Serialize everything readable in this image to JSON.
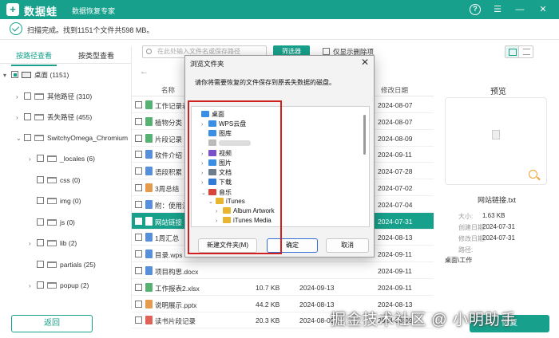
{
  "app": {
    "name": "数据蛙",
    "subtitle": "数据恢复专家",
    "help": "?",
    "menu": "☰",
    "minimize": "—",
    "close": "✕"
  },
  "status": {
    "text": "扫描完成。找到1151个文件共598 MB。"
  },
  "left_tabs": [
    "按路径查看",
    "按类型查看"
  ],
  "tree": [
    {
      "label": "桌面 (1151)",
      "level": 0,
      "arrow": "▾",
      "type": "drive"
    },
    {
      "label": "其他路径 (310)",
      "level": 1,
      "arrow": "›",
      "type": "folder"
    },
    {
      "label": "丢失路径 (455)",
      "level": 1,
      "arrow": "›",
      "type": "folder"
    },
    {
      "label": "SwitchyOmega_Chromium",
      "level": 1,
      "arrow": "⌄",
      "type": "folder"
    },
    {
      "label": "_locales (6)",
      "level": 2,
      "arrow": "›",
      "type": "folder"
    },
    {
      "label": "css (0)",
      "level": 2,
      "arrow": "",
      "type": "folder"
    },
    {
      "label": "img (0)",
      "level": 2,
      "arrow": "",
      "type": "folder"
    },
    {
      "label": "js (0)",
      "level": 2,
      "arrow": "",
      "type": "folder"
    },
    {
      "label": "lib (2)",
      "level": 2,
      "arrow": "›",
      "type": "folder"
    },
    {
      "label": "partials (25)",
      "level": 2,
      "arrow": "",
      "type": "folder"
    },
    {
      "label": "popup (2)",
      "level": 2,
      "arrow": "›",
      "type": "folder"
    }
  ],
  "toolbar": {
    "search_placeholder": "在此处输入文件名或保存路径",
    "filter_label": "筛选器",
    "only_deleted": "仅显示删除项"
  },
  "columns": {
    "name": "名称",
    "mtime": "修改日期"
  },
  "files": [
    {
      "name": "工作记录表",
      "size": "",
      "ctime": "",
      "mtime": "2024-08-07",
      "color": "#3aa35a",
      "selected": false
    },
    {
      "name": "植物分类",
      "size": "",
      "ctime": "",
      "mtime": "2024-08-07",
      "color": "#3aa35a",
      "selected": false
    },
    {
      "name": "片段记录",
      "size": "",
      "ctime": "",
      "mtime": "2024-08-09",
      "color": "#3aa35a",
      "selected": false
    },
    {
      "name": "软件介绍",
      "size": "",
      "ctime": "",
      "mtime": "2024-09-11",
      "color": "#3a7bd5",
      "selected": false
    },
    {
      "name": "语段积累",
      "size": "",
      "ctime": "",
      "mtime": "2024-07-28",
      "color": "#3a7bd5",
      "selected": false
    },
    {
      "name": "3周总结",
      "size": "",
      "ctime": "",
      "mtime": "2024-07-02",
      "color": "#e08a2e",
      "selected": false
    },
    {
      "name": "附：使用注意",
      "size": "",
      "ctime": "",
      "mtime": "2024-07-04",
      "color": "#3a7bd5",
      "selected": false
    },
    {
      "name": "网站链接",
      "size": "",
      "ctime": "",
      "mtime": "2024-07-31",
      "color": "#ffffff",
      "selected": true
    },
    {
      "name": "1周汇总",
      "size": "",
      "ctime": "",
      "mtime": "2024-08-13",
      "color": "#3a7bd5",
      "selected": false
    },
    {
      "name": "目录.wps",
      "size": "",
      "ctime": "",
      "mtime": "2024-09-11",
      "color": "#3a7bd5",
      "selected": false
    },
    {
      "name": "项目构思.docx",
      "size": "",
      "ctime": "",
      "mtime": "2024-09-11",
      "color": "#3a7bd5",
      "selected": false
    },
    {
      "name": "工作报表2.xlsx",
      "size": "10.7 KB",
      "ctime": "2024-09-13",
      "mtime": "2024-09-11",
      "color": "#3aa35a",
      "selected": false
    },
    {
      "name": "说明展示.pptx",
      "size": "44.2 KB",
      "ctime": "2024-08-13",
      "mtime": "2024-08-13",
      "color": "#e08a2e",
      "selected": false
    },
    {
      "name": "读书片段记录",
      "size": "20.3 KB",
      "ctime": "2024-08-09",
      "mtime": "2024-08-09",
      "color": "#d9453a",
      "selected": false
    }
  ],
  "preview": {
    "title": "预览",
    "filename": "网站链接.txt",
    "rows": [
      {
        "label": "大小:",
        "value": "1.63 KB"
      },
      {
        "label": "创建日期:",
        "value": "2024-07-31"
      },
      {
        "label": "修改日期:",
        "value": "2024-07-31"
      },
      {
        "label": "路径:",
        "value": ""
      }
    ],
    "path": "桌面\\工作"
  },
  "bottom": {
    "back": "返回",
    "recover": "恢复"
  },
  "dialog": {
    "title": "浏览文件夹",
    "close": "✕",
    "message": "请你将需要恢复的文件保存到原丢失数据的磁盘。",
    "tree": [
      {
        "label": "桌面",
        "level": 0,
        "arrow": "",
        "color": "#3a8ee6"
      },
      {
        "label": "WPS云盘",
        "level": 1,
        "arrow": "›",
        "color": "#3a8ee6"
      },
      {
        "label": "图库",
        "level": 1,
        "arrow": "",
        "color": "#3a8ee6"
      },
      {
        "label": "",
        "level": 1,
        "arrow": "",
        "color": "#bbbbbb"
      },
      {
        "label": "视频",
        "level": 1,
        "arrow": "›",
        "color": "#7a4fc9"
      },
      {
        "label": "图片",
        "level": 1,
        "arrow": "›",
        "color": "#3a8ee6"
      },
      {
        "label": "文档",
        "level": 1,
        "arrow": "›",
        "color": "#6e7d8c"
      },
      {
        "label": "下载",
        "level": 1,
        "arrow": "›",
        "color": "#2f7bd9"
      },
      {
        "label": "音乐",
        "level": 1,
        "arrow": "⌄",
        "color": "#d9453a"
      },
      {
        "label": "iTunes",
        "level": 2,
        "arrow": "⌄",
        "color": "#e8b530"
      },
      {
        "label": "Album Artwork",
        "level": 3,
        "arrow": "›",
        "color": "#e8b530"
      },
      {
        "label": "iTunes Media",
        "level": 3,
        "arrow": "›",
        "color": "#e8b530"
      }
    ],
    "buttons": {
      "new_folder": "新建文件夹(M)",
      "ok": "确定",
      "cancel": "取消"
    }
  },
  "watermark": "掘金技术社区 @ 小明助手"
}
